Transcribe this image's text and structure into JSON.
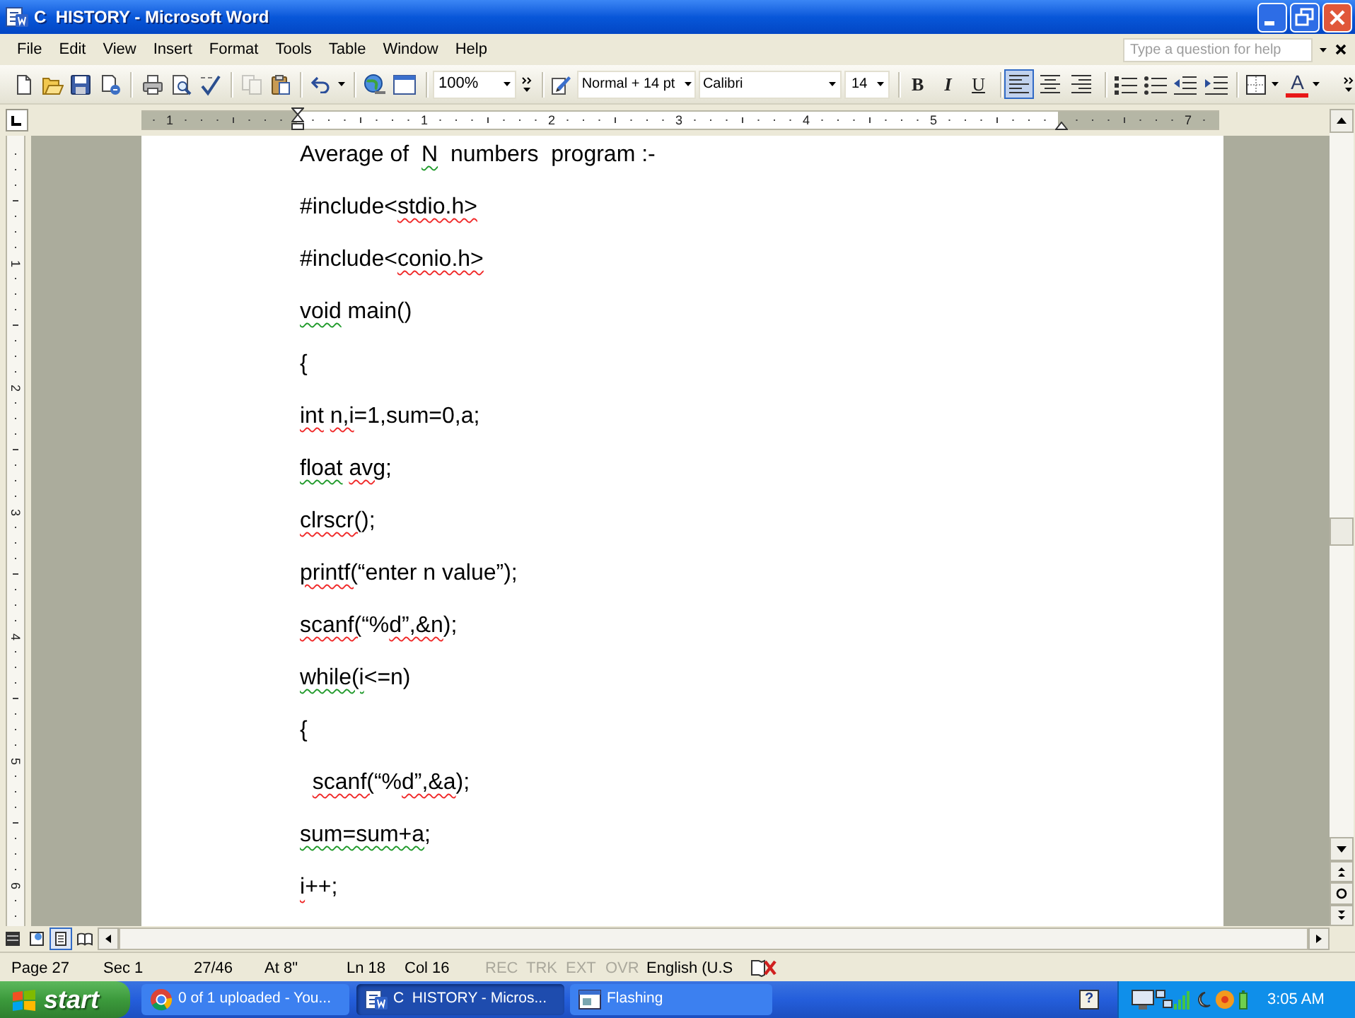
{
  "window": {
    "title": "C  HISTORY - Microsoft Word"
  },
  "menu_bar": {
    "items": [
      "File",
      "Edit",
      "View",
      "Insert",
      "Format",
      "Tools",
      "Table",
      "Window",
      "Help"
    ],
    "help_box": {
      "placeholder": "Type a question for help"
    }
  },
  "toolbar": {
    "copy": {
      "disabled": true
    },
    "zoom": "100%",
    "style": "Normal + 14 pt",
    "font": "Calibri",
    "font_size": "14",
    "text_style_buttons": [
      {
        "kind": "bold",
        "label": "B"
      },
      {
        "kind": "italic",
        "label": "I"
      },
      {
        "kind": "underline",
        "label": "U"
      }
    ],
    "alignment": [
      {
        "selected": true
      },
      {
        "selected": false
      },
      {
        "selected": false
      }
    ],
    "font_color": {
      "label": "A"
    }
  },
  "ruler": {
    "marks": [
      {
        "kind": "number",
        "text": "1"
      },
      {
        "kind": "indent"
      },
      {
        "kind": "number",
        "text": "1"
      },
      {
        "kind": "number",
        "text": "2"
      },
      {
        "kind": "number",
        "text": "3"
      },
      {
        "kind": "number",
        "text": "4"
      },
      {
        "kind": "number",
        "text": "5"
      },
      {
        "kind": "right-indent"
      },
      {
        "kind": "number",
        "text": "7"
      }
    ]
  },
  "vertical_ruler": {
    "labels": [
      "1",
      "2",
      "3",
      "4",
      "5",
      "6"
    ]
  },
  "document": {
    "lines": [
      {
        "segments": [
          {
            "kind": "plain",
            "text": "Average of  "
          },
          {
            "kind": "grammar",
            "text": "N"
          },
          {
            "kind": "plain",
            "text": "  numbers  program :-"
          }
        ]
      },
      {
        "segments": [
          {
            "kind": "plain",
            "text": "#include<"
          },
          {
            "kind": "spelling",
            "text": "stdio.h>"
          }
        ]
      },
      {
        "segments": [
          {
            "kind": "plain",
            "text": "#include<"
          },
          {
            "kind": "spelling",
            "text": "conio.h>"
          }
        ]
      },
      {
        "segments": [
          {
            "kind": "grammar",
            "text": "void"
          },
          {
            "kind": "plain",
            "text": " main()"
          }
        ]
      },
      {
        "segments": [
          {
            "kind": "plain",
            "text": "{"
          }
        ]
      },
      {
        "segments": [
          {
            "kind": "spelling",
            "text": "int "
          },
          {
            "kind": "spelling",
            "text": "n,i"
          },
          {
            "kind": "plain",
            "text": "=1,sum=0,a;"
          }
        ]
      },
      {
        "segments": [
          {
            "kind": "grammar",
            "text": "float "
          },
          {
            "kind": "spelling",
            "text": "avg"
          },
          {
            "kind": "plain",
            "text": ";"
          }
        ]
      },
      {
        "segments": [
          {
            "kind": "spelling",
            "text": "clrscr("
          },
          {
            "kind": "plain",
            "text": ");"
          }
        ]
      },
      {
        "segments": [
          {
            "kind": "spelling",
            "text": "printf("
          },
          {
            "kind": "plain",
            "text": "“enter n value”);"
          }
        ]
      },
      {
        "segments": [
          {
            "kind": "spelling",
            "text": "scanf("
          },
          {
            "kind": "plain",
            "text": "“%"
          },
          {
            "kind": "spelling",
            "text": "d”,&n"
          },
          {
            "kind": "plain",
            "text": ");"
          }
        ]
      },
      {
        "segments": [
          {
            "kind": "grammar",
            "text": "while(i"
          },
          {
            "kind": "plain",
            "text": "<=n)"
          }
        ]
      },
      {
        "segments": [
          {
            "kind": "plain",
            "text": "{"
          }
        ]
      },
      {
        "segments": [
          {
            "kind": "spelling",
            "text": "  scanf("
          },
          {
            "kind": "plain",
            "text": "“%"
          },
          {
            "kind": "spelling",
            "text": "d”,&a"
          },
          {
            "kind": "plain",
            "text": ");"
          }
        ]
      },
      {
        "segments": [
          {
            "kind": "grammar",
            "text": "sum=sum+a"
          },
          {
            "kind": "plain",
            "text": ";"
          }
        ]
      },
      {
        "segments": [
          {
            "kind": "spelling",
            "text": "i"
          },
          {
            "kind": "plain",
            "text": "++;"
          }
        ]
      }
    ]
  },
  "view_buttons": [
    {
      "selected": false
    },
    {
      "selected": false
    },
    {
      "selected": true
    },
    {
      "selected": false
    }
  ],
  "status_bar": {
    "items": [
      {
        "text": "Page 27",
        "disabled": false
      },
      {
        "text": "Sec 1",
        "disabled": false
      },
      {
        "text": "27/46",
        "disabled": false
      },
      {
        "text": "At 8\"",
        "disabled": false
      },
      {
        "text": "Ln 18",
        "disabled": false
      },
      {
        "text": "Col 16",
        "disabled": false
      },
      {
        "text": "REC",
        "disabled": true
      },
      {
        "text": "TRK",
        "disabled": true
      },
      {
        "text": "EXT",
        "disabled": true
      },
      {
        "text": "OVR",
        "disabled": true
      },
      {
        "text": "English (U.S",
        "disabled": false
      }
    ]
  },
  "taskbar": {
    "start": "start",
    "tasks": [
      {
        "label": "0 of 1 uploaded - You...",
        "selected": false
      },
      {
        "label": "C  HISTORY - Micros...",
        "selected": true
      },
      {
        "label": "Flashing",
        "selected": false
      }
    ],
    "help": "?",
    "clock": "3:05 AM"
  }
}
